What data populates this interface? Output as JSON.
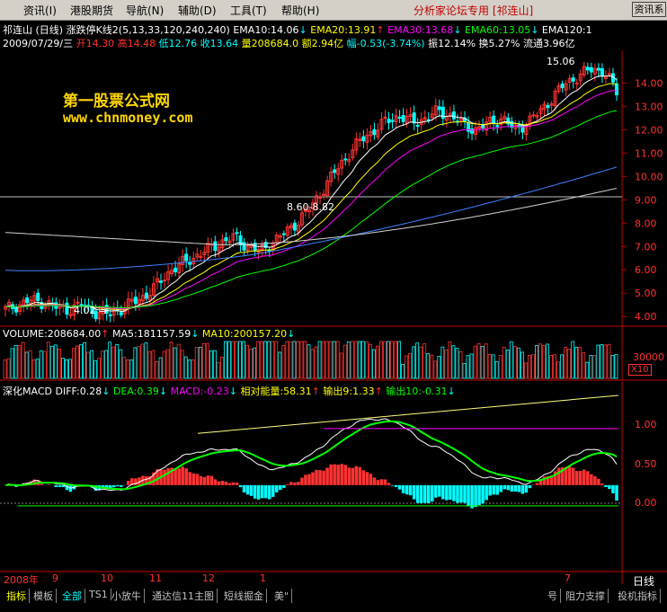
{
  "menu": [
    "资讯(I)",
    "港股期货",
    "导航(N)",
    "辅助(D)",
    "工具(T)",
    "帮助(H)"
  ],
  "headline": "分析家论坛专用 [祁连山]",
  "system_button": "资讯系",
  "title_line": {
    "stock": "祁连山 (日线)",
    "indicator": "涨跌停K线2(5,13,33,120,240,240)",
    "ema10": "EMA10:14.06",
    "ema20": "EMA20:13.91",
    "ema30": "EMA30:13.68",
    "ema60": "EMA60:13.05",
    "ema120": "EMA120:1"
  },
  "quote_line": {
    "date": "2009/07/29/三",
    "open": "开14.30",
    "high": "高14.48",
    "low": "低12.76",
    "close": "收13.64",
    "volume": "量208684.0",
    "amount": "额2.94亿",
    "change": "幅-0.53(-3.74%)",
    "amplitude": "振12.14%",
    "turnover": "换5.27%",
    "float": "流通3.96亿"
  },
  "watermark": {
    "line1": "第一股票公式网",
    "line2": "www.chnmoney.com"
  },
  "price_labels": {
    "high": "15.06",
    "low": "4.02",
    "mid": "8.60-8.82"
  },
  "price_axis": [
    "14.00",
    "13.00",
    "12.00",
    "11.00",
    "10.00",
    "9.00",
    "8.00",
    "7.00",
    "6.00",
    "5.00",
    "4.00"
  ],
  "volume_line": {
    "vol": "VOLUME:208684.00",
    "ma5": "MA5:181157.59",
    "ma10": "MA10:200157.20"
  },
  "volume_axis": {
    "value": "30000",
    "unit": "X10"
  },
  "macd_line": {
    "name": "深化MACD",
    "diff": "DIFF:0.28",
    "dea": "DEA:0.39",
    "macd": "MACD:-0.23",
    "energy": "相对能量:58.31",
    "out9": "输出9:1.33",
    "out10": "输出10:-0.31"
  },
  "macd_axis": [
    "1.00",
    "0.50",
    "0.00"
  ],
  "time_axis": [
    "2008年",
    "9",
    "10",
    "11",
    "12",
    "1",
    "7"
  ],
  "period_label": "日线",
  "tabs_left": [
    "指标",
    "模板",
    "全部",
    "TS1",
    "小放牛",
    "通达信11主图",
    "短线掘金",
    "美\""
  ],
  "tabs_right": [
    "号",
    "阻力支撑",
    "投机指标"
  ],
  "colors": {
    "up": "#ff3232",
    "down": "#00ffff",
    "ema10": "#ffffff",
    "ema20": "#ffff00",
    "ema30": "#ff00ff",
    "ema60": "#00ff00",
    "ema120": "#00ffff",
    "axis": "#c00000",
    "menubar": "#d4d0c8"
  },
  "chart_data": {
    "type": "candlestick",
    "price_range": [
      3.7,
      15.4
    ],
    "trend_price": [
      4.3,
      4.5,
      4.7,
      4.6,
      4.4,
      4.3,
      4.5,
      4.2,
      4.1,
      4.3,
      4.6,
      4.9,
      5.4,
      6.0,
      6.3,
      6.6,
      6.9,
      7.2,
      7.4,
      7.0,
      6.8,
      7.2,
      7.6,
      8.1,
      8.7,
      9.5,
      10.3,
      11.0,
      11.6,
      12.0,
      12.4,
      12.6,
      12.3,
      12.5,
      12.8,
      12.6,
      12.2,
      12.0,
      12.3,
      12.5,
      12.0,
      12.3,
      12.8,
      13.4,
      14.0,
      14.3,
      14.6,
      14.5,
      13.64
    ],
    "ema120_range": [
      5.5,
      10.4
    ],
    "macd_range": [
      -1.2,
      1.3
    ]
  }
}
